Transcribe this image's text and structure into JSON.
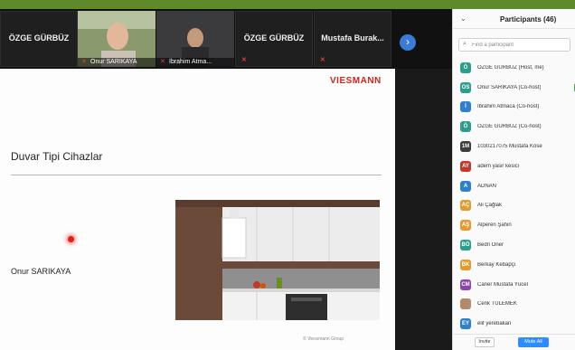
{
  "strip": {
    "tiles": [
      {
        "name": "ÖZGE GÜRBÜZ"
      },
      {
        "name": "ÖZGE GÜRBÜZ"
      },
      {
        "name": "Mustafa  Burak..."
      }
    ],
    "videos": [
      {
        "label": "Onur SARIKAYA"
      },
      {
        "label": "İbrahim Atma..."
      }
    ],
    "next_icon": "chevron-right-icon"
  },
  "slide": {
    "brand": "VIESMANN",
    "title": "Duvar Tipi Cihazlar",
    "presenter": "Onur SARIKAYA",
    "copyright": "© Viessmann Group"
  },
  "panel": {
    "title": "Participants (46)",
    "search_placeholder": "Find a participant",
    "invite_label": "Invite",
    "mute_all_label": "Mute All",
    "participants": [
      {
        "initials": "Ö",
        "name": "ÖZGE GÜRBÜZ (Host, me)",
        "color": "#2b9e8c"
      },
      {
        "initials": "OS",
        "name": "Onur SARIKAYA (Co-host)",
        "color": "#2b9e8c"
      },
      {
        "initials": "İ",
        "name": "İbrahim Atmaca (Co-host)",
        "color": "#2e7fcc"
      },
      {
        "initials": "Ö",
        "name": "ÖZGE GÜRBÜZ (Co-host)",
        "color": "#2b9e8c"
      },
      {
        "initials": "1M",
        "name": "1030217075 Mustafa Köse",
        "color": "#3d3d3d"
      },
      {
        "initials": "AY",
        "name": "adem yasir kesici",
        "color": "#c0392b"
      },
      {
        "initials": "A",
        "name": "ADNAN",
        "color": "#2e7fcc"
      },
      {
        "initials": "AÇ",
        "name": "Ali Çağlak",
        "color": "#e39b2e"
      },
      {
        "initials": "AŞ",
        "name": "Alperen Şahin",
        "color": "#e39b2e"
      },
      {
        "initials": "BÖ",
        "name": "Bedri Öner",
        "color": "#2b9e8c"
      },
      {
        "initials": "BK",
        "name": "Berkay Kebapçı",
        "color": "#e39b2e"
      },
      {
        "initials": "CM",
        "name": "Caner Mustafa Yücel",
        "color": "#8e44ad"
      },
      {
        "initials": "",
        "name": "Cenk TÜLEMEK",
        "color": "#b08a6a"
      },
      {
        "initials": "EY",
        "name": "elif yerebakan",
        "color": "#2e7fcc"
      }
    ]
  }
}
